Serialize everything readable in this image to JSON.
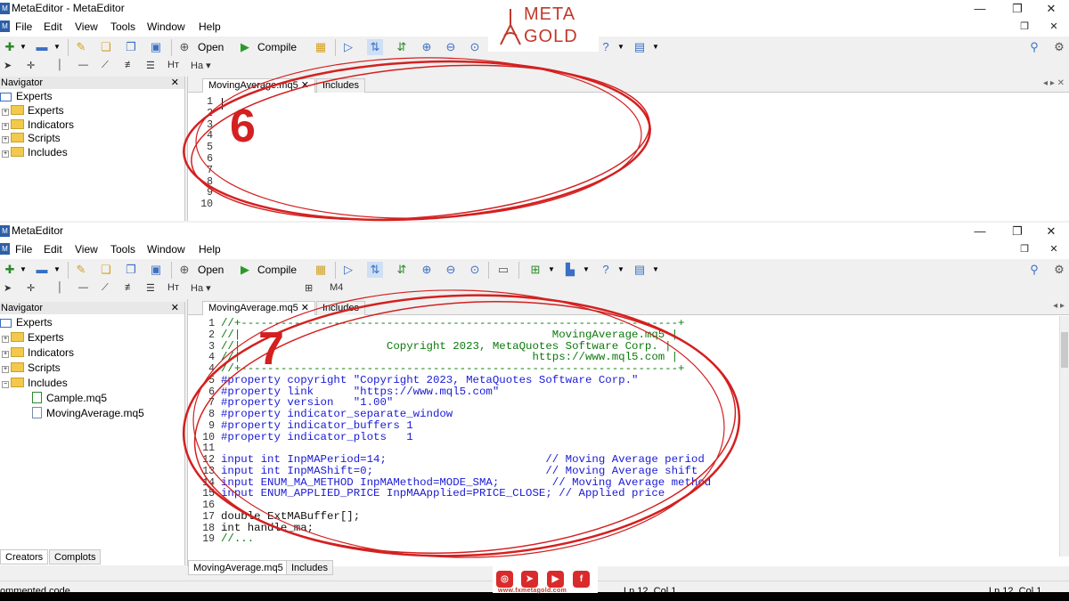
{
  "window1": {
    "title": "MetaEditor - MetaEditor",
    "menu": [
      "File",
      "Edit",
      "View",
      "Tools",
      "Window",
      "Help"
    ],
    "toolbar": {
      "open_label": "Open",
      "compile_label": "Compile"
    },
    "navigator": {
      "header": "Navigator",
      "items": [
        "Experts",
        "Indicators",
        "Scripts",
        "Includes"
      ]
    },
    "tabs": [
      "MovingAverage.mq5",
      "Includes"
    ],
    "line_numbers": [
      "1",
      "2",
      "3",
      "4",
      "5",
      "6",
      "7",
      "8",
      "9",
      "10"
    ]
  },
  "window2": {
    "title": "MetaEditor",
    "menu": [
      "File",
      "Edit",
      "View",
      "Tools",
      "Window",
      "Help"
    ],
    "toolbar": {
      "open_label": "Open",
      "compile_label": "Compile"
    },
    "navigator": {
      "header": "Navigator",
      "items": [
        "Experts",
        "Experts",
        "Indicators",
        "Scripts",
        "Includes"
      ],
      "files": [
        "Cample.mq5",
        "MovingAverage.mq5"
      ],
      "bottom_tabs": [
        "Creators",
        "Complots"
      ]
    },
    "tabs": [
      "MovingAverage.mq5",
      "Includes"
    ],
    "bottom_tabs": [
      "MovingAverage.mq5",
      "Includes"
    ],
    "code_lines": [
      {
        "n": "1",
        "t": "//+------------------------------------------------------------------+"
      },
      {
        "n": "2",
        "t": "//|                                               MovingAverage.mq5 |"
      },
      {
        "n": "3",
        "t": "//|                      Copyright 2023, MetaQuotes Software Corp. |"
      },
      {
        "n": "4",
        "t": "//|                                            https://www.mql5.com |"
      },
      {
        "n": "4",
        "t": "//+------------------------------------------------------------------+"
      },
      {
        "n": "5",
        "t": "#property copyright \"Copyright 2023, MetaQuotes Software Corp.\""
      },
      {
        "n": "6",
        "t": "#property link      \"https://www.mql5.com\""
      },
      {
        "n": "7",
        "t": "#property version   \"1.00\""
      },
      {
        "n": "8",
        "t": "#property indicator_separate_window"
      },
      {
        "n": "9",
        "t": "#property indicator_buffers 1"
      },
      {
        "n": "10",
        "t": "#property indicator_plots   1"
      },
      {
        "n": "11",
        "t": ""
      },
      {
        "n": "12",
        "t": "input int InpMAPeriod=14;                        // Moving Average period"
      },
      {
        "n": "13",
        "t": "input int InpMAShift=0;                          // Moving Average shift"
      },
      {
        "n": "14",
        "t": "input ENUM_MA_METHOD InpMAMethod=MODE_SMA;        // Moving Average method"
      },
      {
        "n": "15",
        "t": "input ENUM_APPLIED_PRICE InpMAApplied=PRICE_CLOSE; // Applied price"
      },
      {
        "n": "16",
        "t": ""
      },
      {
        "n": "17",
        "t": "double ExtMABuffer[];"
      },
      {
        "n": "18",
        "t": "int handle_ma;"
      },
      {
        "n": "19",
        "t": "//..."
      }
    ],
    "status_left": "ommented code",
    "status_mid": "Ln 12, Col 1",
    "status_right": "Ln 12, Col 1"
  },
  "watermark": {
    "line1": "META",
    "line2": "GOLD",
    "url": "www.fxmetagold.com"
  },
  "annotations": {
    "step_a": "6",
    "step_b": "7"
  },
  "colors": {
    "annotation": "#d42020",
    "brand": "#c0392b",
    "comment": "#0b7a0b",
    "keyword": "#1a1ad6"
  }
}
